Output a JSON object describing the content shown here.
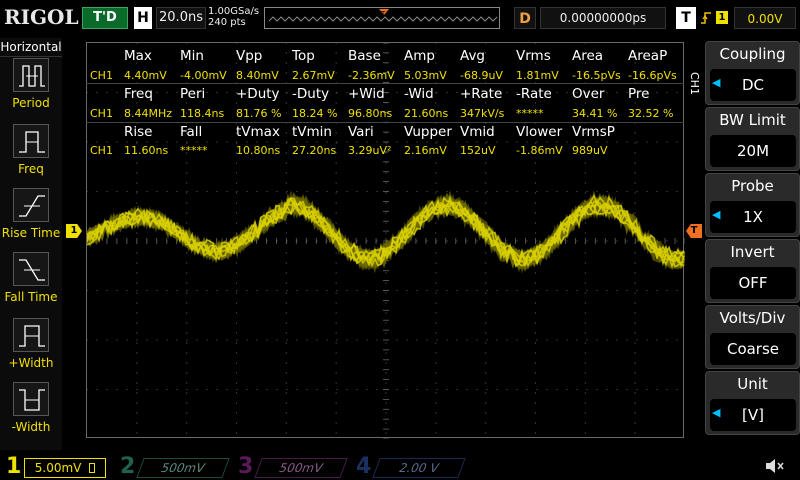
{
  "top": {
    "logo": "RIGOL",
    "run_status": "T'D",
    "horizontal_badge": "H",
    "timebase": "20.0ns",
    "sample_rate": "1.00GSa/s",
    "sample_points": "240 pts",
    "delay_badge": "D",
    "delay_value": "0.00000000ps",
    "trigger_badge": "T",
    "trigger_source": "1",
    "trigger_level": "0.00V",
    "colors": {
      "ch1": "#f0e000",
      "ch2": "#00c0a0",
      "ch3": "#c000c0",
      "ch4": "#3070ff",
      "status_green": "#0a6a2a"
    }
  },
  "left_panel": {
    "title": "Horizontal",
    "items": [
      {
        "label": "Period",
        "icon": "period-icon"
      },
      {
        "label": "Freq",
        "icon": "freq-icon"
      },
      {
        "label": "Rise Time",
        "icon": "rise-time-icon"
      },
      {
        "label": "Fall Time",
        "icon": "fall-time-icon"
      },
      {
        "label": "+Width",
        "icon": "pos-width-icon"
      },
      {
        "label": "-Width",
        "icon": "neg-width-icon"
      }
    ]
  },
  "measurements": {
    "channel": "CH1",
    "row1_headers": [
      "Max",
      "Min",
      "Vpp",
      "Top",
      "Base",
      "Amp",
      "Avg",
      "Vrms",
      "Area",
      "AreaP"
    ],
    "row1_values": [
      "4.40mV",
      "-4.00mV",
      "8.40mV",
      "2.67mV",
      "-2.36mV",
      "5.03mV",
      "-68.9uV",
      "1.81mV",
      "-16.5pVs",
      "-16.6pVs"
    ],
    "row2_headers": [
      "Freq",
      "Peri",
      "+Duty",
      "-Duty",
      "+Wid",
      "-Wid",
      "+Rate",
      "-Rate",
      "Over",
      "Pre"
    ],
    "row2_values": [
      "8.44MHz",
      "118.4ns",
      "81.76 %",
      "18.24 %",
      "96.80ns",
      "21.60ns",
      "347kV/s",
      "*****",
      "34.41 %",
      "32.52 %"
    ],
    "row3_headers": [
      "Rise",
      "Fall",
      "tVmax",
      "tVmin",
      "Vari",
      "Vupper",
      "Vmid",
      "Vlower",
      "VrmsP"
    ],
    "row3_values": [
      "11.60ns",
      "*****",
      "10.80ns",
      "27.20ns",
      "3.29uV²",
      "2.16mV",
      "152uV",
      "-1.86mV",
      "989uV"
    ]
  },
  "right_panel": {
    "channel_tag": "CH1",
    "groups": [
      {
        "title": "Coupling",
        "value": "DC",
        "has_arrow": true
      },
      {
        "title": "BW Limit",
        "value": "20M",
        "has_arrow": false
      },
      {
        "title": "Probe",
        "value": "1X",
        "has_arrow": true
      },
      {
        "title": "Invert",
        "value": "OFF",
        "has_arrow": false
      },
      {
        "title": "Volts/Div",
        "value": "Coarse",
        "has_arrow": false
      },
      {
        "title": "Unit",
        "value": "[V]",
        "has_arrow": true
      }
    ]
  },
  "markers": {
    "ch1_marker": "1",
    "trigger_marker": "T"
  },
  "bottom": {
    "channels": [
      {
        "num": "1",
        "scale": "5.00mV",
        "active": true
      },
      {
        "num": "2",
        "scale": "500mV",
        "active": false
      },
      {
        "num": "3",
        "scale": "500mV",
        "active": false
      },
      {
        "num": "4",
        "scale": "2.00 V",
        "active": false
      }
    ]
  }
}
